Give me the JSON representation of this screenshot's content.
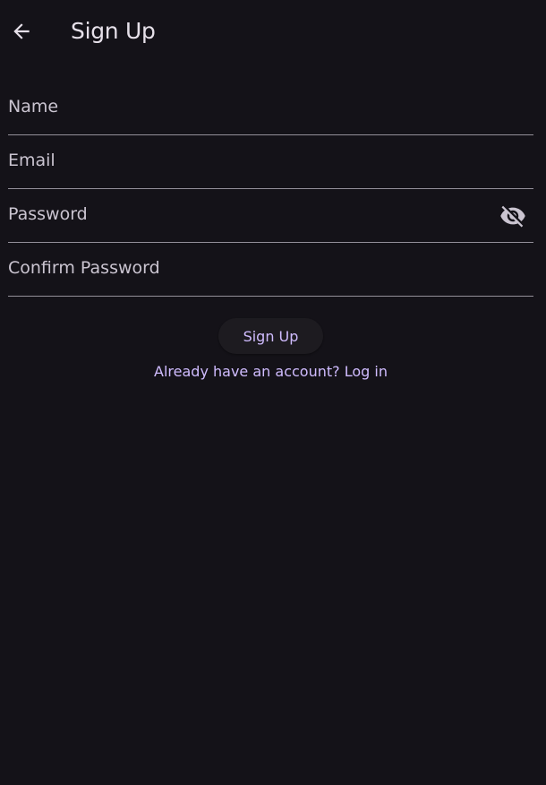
{
  "appbar": {
    "title": "Sign Up",
    "back_icon": "arrow-back-icon"
  },
  "form": {
    "name": {
      "placeholder": "Name",
      "value": ""
    },
    "email": {
      "placeholder": "Email",
      "value": ""
    },
    "password": {
      "placeholder": "Password",
      "value": "",
      "toggle_icon": "visibility-off-icon"
    },
    "confirm_password": {
      "placeholder": "Confirm Password",
      "value": ""
    }
  },
  "actions": {
    "signup_label": "Sign Up",
    "login_link": "Already have an account? Log in"
  },
  "colors": {
    "background": "#141218",
    "text": "#e6e0e9",
    "hint": "#cac4d0",
    "divider": "#938f99",
    "accent": "#d0bcff",
    "button_bg": "#1d1b20"
  }
}
